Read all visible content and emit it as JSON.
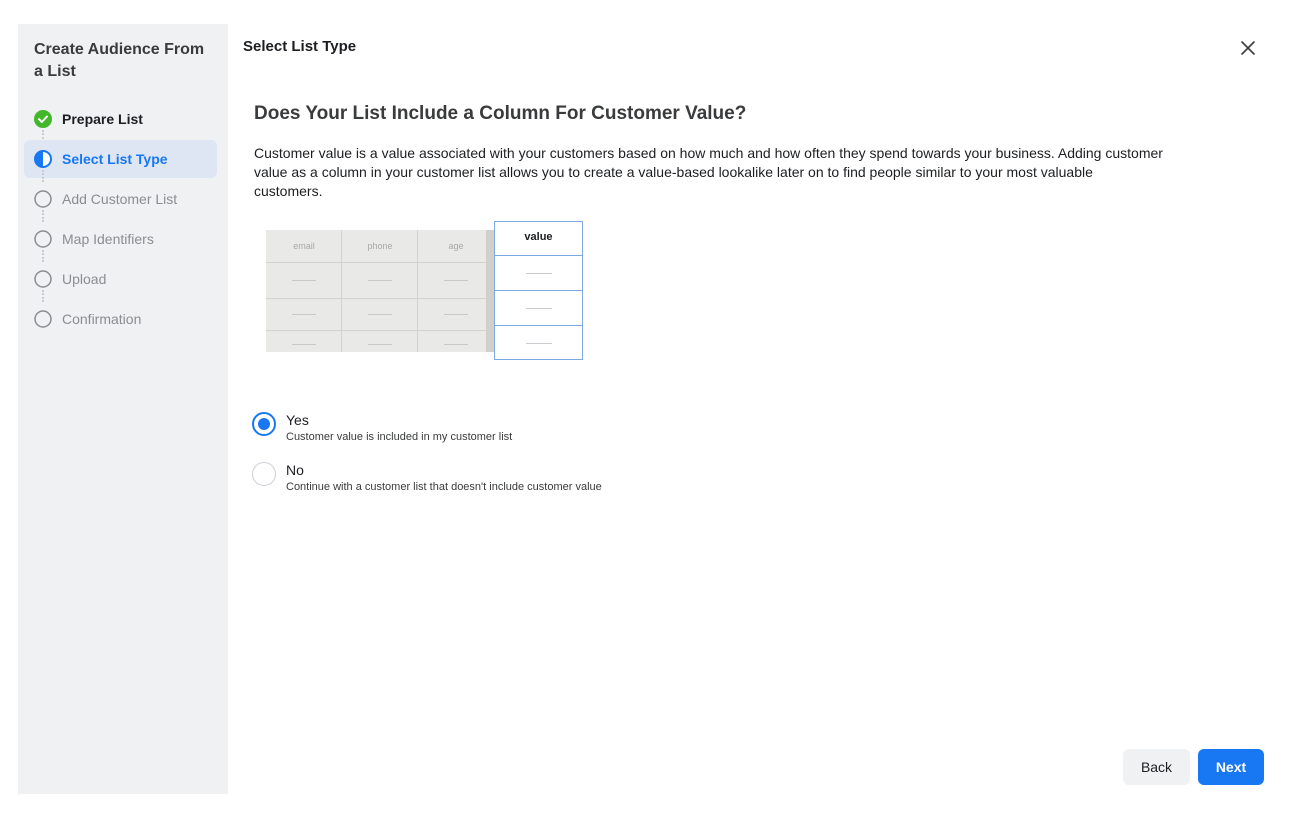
{
  "sidebar": {
    "title": "Create Audience From a List",
    "steps": [
      {
        "label": "Prepare List",
        "state": "done",
        "icon": "check-circle-icon"
      },
      {
        "label": "Select List Type",
        "state": "active",
        "icon": "half-circle-icon"
      },
      {
        "label": "Add Customer List",
        "state": "pending",
        "icon": "empty-circle-icon"
      },
      {
        "label": "Map Identifiers",
        "state": "pending",
        "icon": "empty-circle-icon"
      },
      {
        "label": "Upload",
        "state": "pending",
        "icon": "empty-circle-icon"
      },
      {
        "label": "Confirmation",
        "state": "pending",
        "icon": "empty-circle-icon"
      }
    ]
  },
  "header": {
    "title": "Select List Type",
    "close_icon": "close-icon"
  },
  "main": {
    "question": "Does Your List Include a Column For Customer Value?",
    "description": "Customer value is a value associated with your customers based on how much and how often they spend towards your business. Adding customer value as a column in your customer list allows you to create a value-based lookalike later on to find people similar to your most valuable customers.",
    "illustration": {
      "columns": [
        "email",
        "phone",
        "age"
      ],
      "highlight_column": "value"
    },
    "options": [
      {
        "label": "Yes",
        "sublabel": "Customer value is included in my customer list",
        "selected": true
      },
      {
        "label": "No",
        "sublabel": "Continue with a customer list that doesn't include customer value",
        "selected": false
      }
    ]
  },
  "footer": {
    "back_label": "Back",
    "next_label": "Next"
  },
  "colors": {
    "accent": "#1877f2",
    "success": "#42b72a",
    "sidebar_bg": "#f0f1f2",
    "active_bg": "#dfe6f3"
  }
}
